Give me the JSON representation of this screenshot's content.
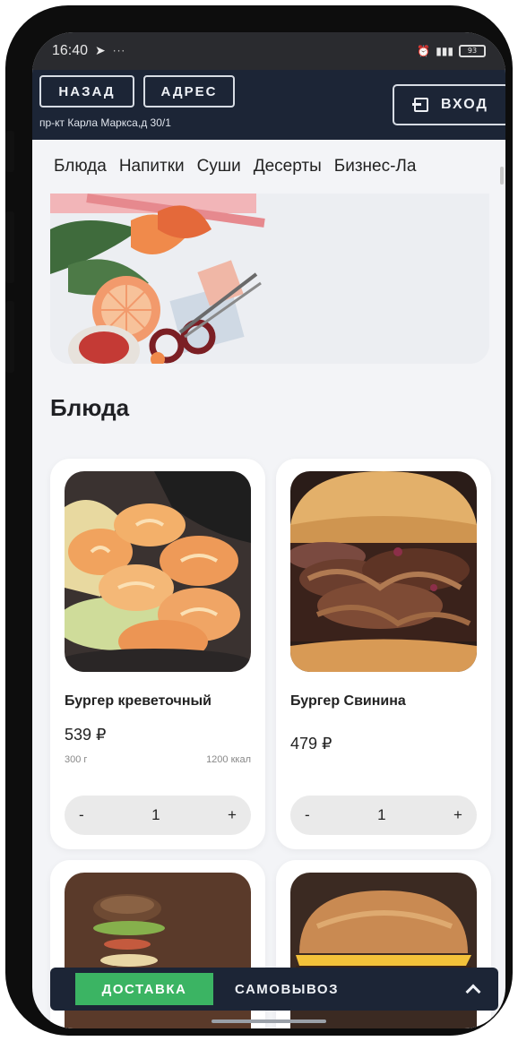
{
  "status_bar": {
    "time": "16:40",
    "telegram_icon": "paper-plane-icon",
    "dots": "···",
    "battery": "93"
  },
  "header": {
    "back_label": "НАЗАД",
    "address_label": "АДРЕС",
    "address_text": "пр-кт Карла Маркса,д 30/1",
    "login_label": "ВХОД",
    "login_icon": "login-icon"
  },
  "categories": [
    "Блюда",
    "Напитки",
    "Суши",
    "Десерты",
    "Бизнес-Ла"
  ],
  "section_title": "Блюда",
  "products": [
    {
      "name": "Бургер креветочный",
      "price": "539 ₽",
      "weight": "300 г",
      "kcal": "1200 ккал",
      "qty": "1",
      "minus": "-",
      "plus": "+"
    },
    {
      "name": "Бургер Свинина",
      "price": "479 ₽",
      "qty": "1",
      "minus": "-",
      "plus": "+"
    }
  ],
  "delivery_bar": {
    "delivery_label": "ДОСТАВКА",
    "pickup_label": "САМОВЫВОЗ",
    "expand_icon": "chevron-up-icon"
  },
  "colors": {
    "header_bg": "#1c2536",
    "accent_green": "#3bb463",
    "screen_bg": "#f3f4f7"
  }
}
